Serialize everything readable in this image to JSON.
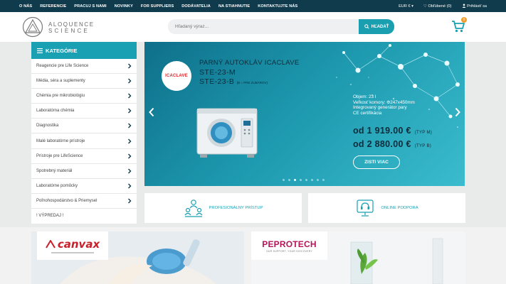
{
  "topnav": [
    "O NÁS",
    "REFERENCIE",
    "PRACUJ S NAMI",
    "NOVINKY",
    "FOR SUPPLIERS",
    "DODÁVATELIA",
    "NA STIAHNUTIE",
    "KONTAKTUJTE NÁS"
  ],
  "topright": {
    "currency": "EUR € ▾",
    "favorites": "♡ Obľúbené (0)",
    "login": "Prihlásiť sa"
  },
  "logo": {
    "line1": "ALOQUENCE",
    "line2": "SCIENCE"
  },
  "search": {
    "placeholder": "Hľadaný výraz...",
    "button": "HĽADAŤ"
  },
  "cart": {
    "count": "0"
  },
  "sidebar": {
    "title": "KATEGÓRIE",
    "items": [
      "Reagencie pre Life Science",
      "Média, séra a suplementy",
      "Chémia pre mikrobiológiu",
      "Laboratórna chémia",
      "Diagnostika",
      "Malé laboratórne prístroje",
      "Prístroje pre LifeScience",
      "Spotrebný materiál",
      "Laboratórne pomôcky",
      "Poľnohospodárstvo & Priemysel",
      "! VÝPREDAJ !"
    ]
  },
  "hero": {
    "brand": "ICACLAVE",
    "title": "PARNÝ AUTOKLÁV ICACLAVE",
    "model1": "STE-23-M",
    "model2": "STE-23-B",
    "model2_note": "(B = PRE ZUBÁROV)",
    "specs": [
      "Objem: 23 l",
      "Veľkosť komory: Φ247x450mm",
      "Integrovaný generátor pary",
      "CE certifikácia"
    ],
    "price1": "od 1 919.00 €",
    "price1_note": "(TYP M)",
    "price2": "od 2 880.00 €",
    "price2_note": "(TYP B)",
    "button": "ZISTI VIAC",
    "slide_count": 8,
    "active_slide": 3
  },
  "features": [
    "PROFESIONÁLNY PRÍSTUP",
    "ONLINE PODPORA"
  ],
  "banners": [
    {
      "brand": "canvax",
      "tagline": ""
    },
    {
      "brand": "PEPROTECH",
      "tagline": "OUR SUPPORT, YOUR DISCOVERY"
    }
  ],
  "colors": {
    "topbar": "#0f3b4c",
    "accent": "#1aa0b3",
    "price": "#0d2c3a",
    "cart_badge": "#f39c2b"
  }
}
